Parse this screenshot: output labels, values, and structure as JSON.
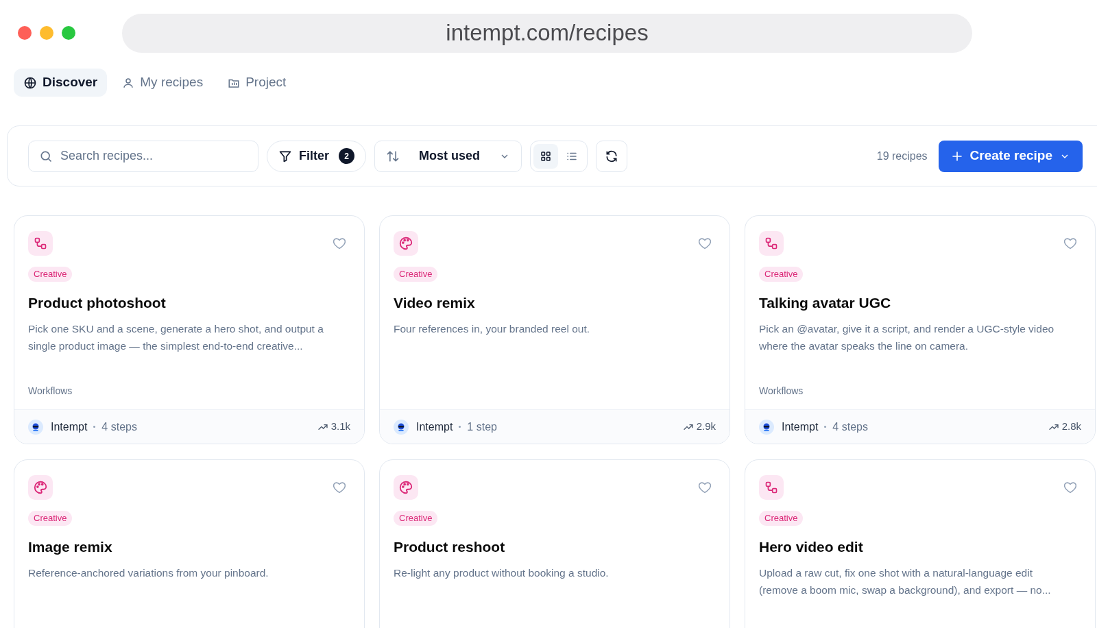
{
  "browser": {
    "url": "intempt.com/recipes"
  },
  "tabs": [
    {
      "label": "Discover",
      "selected": true
    },
    {
      "label": "My recipes",
      "selected": false
    },
    {
      "label": "Project",
      "selected": false
    }
  ],
  "toolbar": {
    "search": {
      "placeholder": "Search recipes..."
    },
    "filter": {
      "label": "Filter",
      "count": "2"
    },
    "sort": {
      "label": "Most used"
    },
    "views": [
      {
        "kind": "grid",
        "selected": true
      },
      {
        "kind": "list",
        "selected": false
      }
    ],
    "count": "19 recipes",
    "create_button": "Create recipe"
  },
  "cards": [
    {
      "kind": "workflow",
      "tag": "Creative",
      "title": "Product photoshoot",
      "description": "Pick one SKU and a scene, generate a hero shot, and output a single product image — the simplest end-to-end creative...",
      "category": "Workflows",
      "favorited": false,
      "footer": {
        "author": "Intempt",
        "steps": "4 steps",
        "uses": "3.1k"
      }
    },
    {
      "kind": "palette",
      "tag": "Creative",
      "title": "Video remix",
      "description": "Four references in, your branded reel out.",
      "favorited": false,
      "footer": {
        "author": "Intempt",
        "steps": "1 step",
        "uses": "2.9k"
      }
    },
    {
      "kind": "workflow",
      "tag": "Creative",
      "title": "Talking avatar UGC",
      "description": "Pick an @avatar, give it a script, and render a UGC-style video where the avatar speaks the line on camera.",
      "category": "Workflows",
      "favorited": false,
      "footer": {
        "author": "Intempt",
        "steps": "4 steps",
        "uses": "2.8k"
      }
    },
    {
      "kind": "palette",
      "tag": "Creative",
      "title": "Image remix",
      "description": "Reference-anchored variations from your pinboard.",
      "favorited": false
    },
    {
      "kind": "palette",
      "tag": "Creative",
      "title": "Product reshoot",
      "description": "Re-light any product without booking a studio.",
      "favorited": false
    },
    {
      "kind": "workflow",
      "tag": "Creative",
      "title": "Hero video edit",
      "description": "Upload a raw cut, fix one shot with a natural-language edit (remove a boom mic, swap a background), and export — no...",
      "favorited": false
    }
  ]
}
